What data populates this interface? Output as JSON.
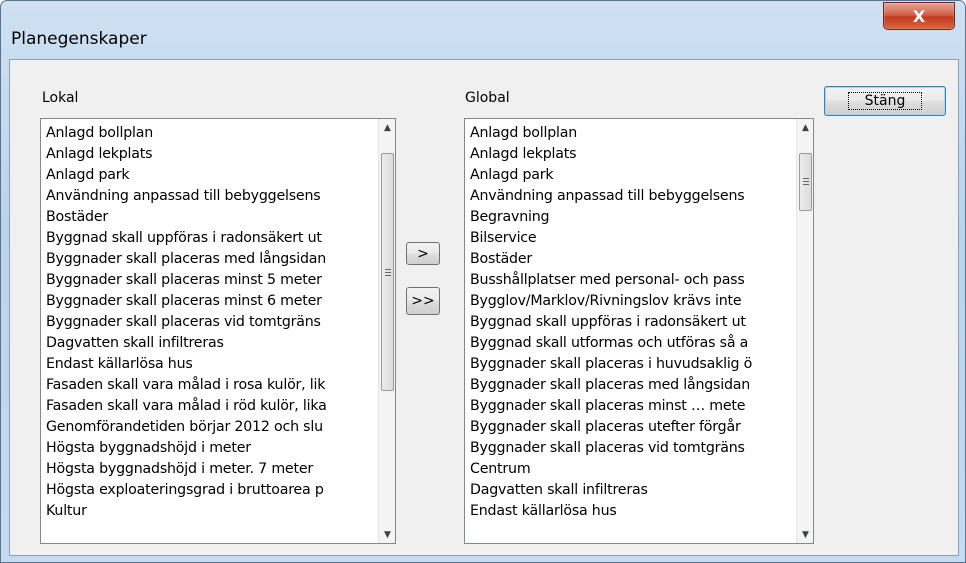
{
  "window": {
    "title": "Planegenskaper",
    "close_glyph": "X"
  },
  "close_label": "Stäng",
  "transfer": {
    "move_one": ">",
    "move_all": ">>"
  },
  "local": {
    "label": "Lokal",
    "items": [
      "Anlagd bollplan",
      "Anlagd lekplats",
      "Anlagd park",
      "Användning anpassad till bebyggelsens",
      "Bostäder",
      "Byggnad skall uppföras i radonsäkert ut",
      "Byggnader skall placeras med långsidan",
      "Byggnader skall placeras minst 5 meter",
      "Byggnader skall placeras minst 6 meter",
      "Byggnader skall placeras vid tomtgräns",
      "Dagvatten skall infiltreras",
      "Endast källarlösa hus",
      "Fasaden skall vara målad i rosa kulör, lik",
      "Fasaden skall vara målad i röd kulör, lika",
      "Genomförandetiden börjar 2012 och slu",
      "Högsta byggnadshöjd i meter",
      "Högsta byggnadshöjd i meter. 7 meter",
      "Högsta exploateringsgrad i bruttoarea p",
      "Kultur"
    ]
  },
  "global": {
    "label": "Global",
    "items": [
      "Anlagd bollplan",
      "Anlagd lekplats",
      "Anlagd park",
      "Användning anpassad till bebyggelsens",
      "Begravning",
      "Bilservice",
      "Bostäder",
      "Busshållplatser med personal- och pass",
      "Bygglov/Marklov/Rivningslov krävs inte",
      "Byggnad skall uppföras i radonsäkert ut",
      "Byggnad skall utformas och utföras så a",
      "Byggnader skall placeras i huvudsaklig ö",
      "Byggnader skall placeras med långsidan",
      "Byggnader skall placeras minst … mete",
      "Byggnader skall placeras utefter förgår",
      "Byggnader skall placeras vid tomtgräns",
      "Centrum",
      "Dagvatten skall infiltreras",
      "Endast källarlösa hus"
    ]
  }
}
